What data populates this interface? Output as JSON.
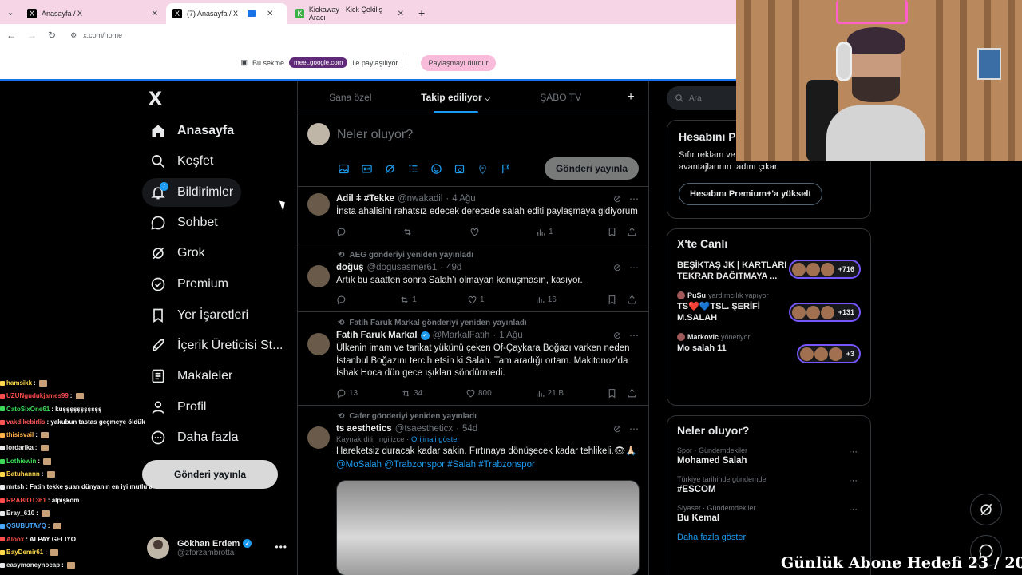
{
  "browser": {
    "tabs": [
      {
        "title": "Anasayfa / X",
        "active": false
      },
      {
        "title": "(7) Anasayfa / X",
        "active": true
      },
      {
        "title": "Kickaway - Kick Çekiliş Aracı",
        "active": false
      }
    ],
    "new_tab": "+",
    "url": "x.com/home"
  },
  "share_bar": {
    "prefix": "Bu sekme",
    "meet_url": "meet.google.com",
    "suffix": "ile paylaşılıyor",
    "stop_label": "Paylaşmayı durdur"
  },
  "leftnav": {
    "logo": "X",
    "items": [
      {
        "label": "Anasayfa",
        "icon": "home-icon"
      },
      {
        "label": "Keşfet",
        "icon": "search-icon"
      },
      {
        "label": "Bildirimler",
        "icon": "bell-icon",
        "badge": "7"
      },
      {
        "label": "Sohbet",
        "icon": "chat-icon"
      },
      {
        "label": "Grok",
        "icon": "grok-icon"
      },
      {
        "label": "Premium",
        "icon": "verified-icon"
      },
      {
        "label": "Yer İşaretleri",
        "icon": "bookmark-icon"
      },
      {
        "label": "İçerik Üreticisi St...",
        "icon": "rocket-icon"
      },
      {
        "label": "Makaleler",
        "icon": "article-icon"
      },
      {
        "label": "Profil",
        "icon": "person-icon"
      },
      {
        "label": "Daha fazla",
        "icon": "more-circle-icon"
      }
    ],
    "post_button": "Gönderi yayınla",
    "profile": {
      "name": "Gökhan Erdem",
      "handle": "@zforzambrotta"
    }
  },
  "chat": [
    {
      "user": "hamsikk",
      "text": "",
      "color": "#ffd84a"
    },
    {
      "user": "UZUNgudukjames99",
      "text": "",
      "color": "#ff4b4b"
    },
    {
      "user": "CatoSixOne61",
      "text": "kuşşşşşşşşşşş",
      "color": "#3cdc5a"
    },
    {
      "user": "vakdikebirlis",
      "text": "yakubun tastas geçmeye öldük",
      "color": "#ff5555"
    },
    {
      "user": "thisisvail",
      "text": "",
      "color": "#ffb347"
    },
    {
      "user": "lordarika",
      "text": "",
      "color": "#e7e9ea"
    },
    {
      "user": "Lothiewin",
      "text": "",
      "color": "#3cdc5a"
    },
    {
      "user": "Batuhannn",
      "text": "",
      "color": "#ffd84a"
    },
    {
      "user": "mrtsh",
      "text": "Fatih tekke şuan dünyanın en iyi mutlu adamı",
      "color": "#e7e9ea"
    },
    {
      "user": "RRABIOT361",
      "text": "alpişkom",
      "color": "#ff4b4b"
    },
    {
      "user": "Eray_610",
      "text": "",
      "color": "#e7e9ea"
    },
    {
      "user": "QSUBUTAYQ",
      "text": "",
      "color": "#4aa8ff"
    },
    {
      "user": "Aloox",
      "text": "ALPAY GELIYO",
      "color": "#ff4b4b"
    },
    {
      "user": "BayDemir61",
      "text": "",
      "color": "#ffd84a"
    },
    {
      "user": "easymoneynocap",
      "text": "",
      "color": "#e7e9ea"
    }
  ],
  "timeline": {
    "tabs": [
      "Sana özel",
      "Takip ediliyor",
      "ŞABO TV"
    ],
    "add_tab": "+",
    "composer": {
      "placeholder": "Neler oluyor?",
      "post_button": "Gönderi yayınla"
    },
    "tweets": [
      {
        "retweeted_by": "",
        "name": "Adil ǂ #Tekke",
        "handle": "@nwakadil",
        "time": "4 Ağu",
        "text": "İnsta ahalisini rahatsız edecek derecede salah editi paylaşmaya gidiyorum",
        "replies": "",
        "reposts": "",
        "likes": "",
        "views": "1"
      },
      {
        "retweeted_by": "AEG gönderiyi yeniden yayınladı",
        "name": "doğuş",
        "handle": "@dogusesmer61",
        "time": "49d",
        "text": "Artık bu saatten sonra Salah’ı olmayan konuşmasın, kasıyor.",
        "replies": "",
        "reposts": "1",
        "likes": "1",
        "views": "16"
      },
      {
        "retweeted_by": "Fatih Faruk Markal gönderiyi yeniden yayınladı",
        "name": "Fatih Faruk Markal",
        "handle": "@MarkalFatih",
        "time": "1 Ağu",
        "text": "Ülkenin imam ve tarikat yükünü çeken Of-Çaykara Boğazı varken neden İstanbul Boğazını tercih etsin ki Salah. Tam aradığı ortam. Makitonoz’da İshak Hoca dün gece ışıkları söndürmedi.",
        "replies": "13",
        "reposts": "34",
        "likes": "800",
        "views": "21 B"
      },
      {
        "retweeted_by": "Cafer gönderiyi yeniden yayınladı",
        "name": "ts aesthetics",
        "handle": "@tsaestheticx",
        "time": "54d",
        "source_label": "Kaynak dili: İngilizce",
        "source_link": "Orijinali göster",
        "text": "Hareketsiz duracak kadar sakin. Fırtınaya dönüşecek kadar tehlikeli.👁🙏🏻",
        "tags": "@MoSalah @Trabzonspor #Salah #Trabzonspor"
      }
    ]
  },
  "right": {
    "search_placeholder": "Ara",
    "premium": {
      "title": "Hesabını P",
      "desc_line1": "Sıfır reklam ve",
      "desc_line2": "avantajlarının tadını çıkar.",
      "button": "Hesabını Premium+'a yükselt"
    },
    "live": {
      "title": "X'te Canlı",
      "items": [
        {
          "host": "",
          "role": "",
          "title": "BEŞİKTAŞ JK | KARTLARI TEKRAR DAĞITMAYA ...",
          "count": "+716"
        },
        {
          "host": "PuSu",
          "role": "yardımcılık yapıyor",
          "title": "TS❤️💙TSL. ŞERİFİ M.SALAH",
          "count": "+131"
        },
        {
          "host": "Markovic",
          "role": "yönetiyor",
          "title": "Mo salah 11",
          "count": "+3"
        }
      ]
    },
    "trends": {
      "title": "Neler oluyor?",
      "items": [
        {
          "context": "Spor · Gündemdekiler",
          "name": "Mohamed Salah"
        },
        {
          "context": "Türkiye tarihinde gündemde",
          "name": "#ESCOM"
        },
        {
          "context": "Siyaset · Gündemdekiler",
          "name": "Bu Kemal"
        }
      ],
      "more": "Daha fazla göster"
    }
  },
  "overlay": {
    "goal_text": "Günlük Abone Hedefi 23 / 20"
  }
}
